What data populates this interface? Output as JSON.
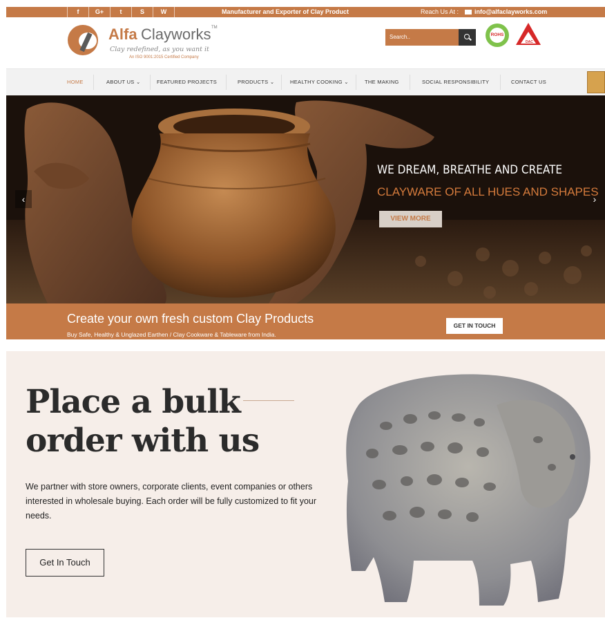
{
  "topbar": {
    "social": [
      "f",
      "G+",
      "t",
      "S",
      "W"
    ],
    "tagline": "Manufacturer and Exporter of Clay Product",
    "reach_label": "Reach Us At :",
    "email": "info@alfaclayworks.com"
  },
  "header": {
    "brand_part1": "Alfa",
    "brand_part2": "Clayworks",
    "tm": "TM",
    "slogan": "Clay redefined, as you want it",
    "iso": "An ISO 9001:2015 Certified Company",
    "search_placeholder": "Search..",
    "badge_rohs": "ROHS",
    "badge_dac": "DAC"
  },
  "nav": {
    "items": [
      "HOME",
      "ABOUT US",
      "FEATURED PROJECTS",
      "PRODUCTS",
      "HEALTHY COOKING",
      "THE MAKING",
      "SOCIAL RESPONSIBILITY",
      "CONTACT US"
    ],
    "dropdown_marker": "⌄"
  },
  "hero": {
    "line1": "WE DREAM, BREATHE AND CREATE",
    "line2": "CLAYWARE OF ALL HUES AND SHAPES",
    "button": "VIEW MORE",
    "prev": "‹",
    "next": "›"
  },
  "cta": {
    "title": "Create your own fresh custom Clay Products",
    "subtitle": "Buy Safe, Healthy & Unglazed Earthen / Clay Cookware & Tableware from India.",
    "button": "GET IN TOUCH"
  },
  "bulk": {
    "title_line1": "Place a bulk",
    "title_line2": "order with us",
    "text": "We partner with store owners, corporate clients, event companies or others interested in wholesale buying. Each order will be fully customized to fit your needs.",
    "button": "Get In Touch"
  },
  "colors": {
    "brand": "#c57a47",
    "dark": "#333333",
    "section_bg": "#f6eee9"
  }
}
